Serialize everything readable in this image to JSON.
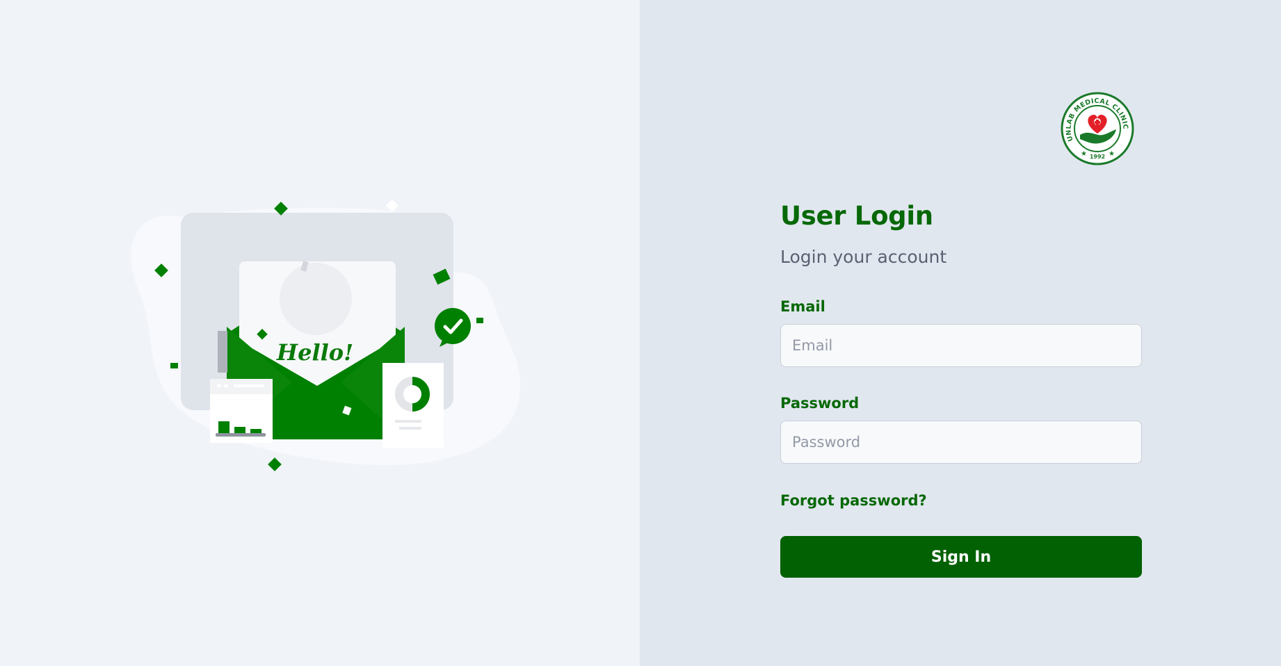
{
  "brand": {
    "logo_text": "UNLAB MEDICAL CLINIC CORP",
    "logo_year": "1992",
    "accent_color": "#066806",
    "button_color": "#026102"
  },
  "illustration": {
    "greeting": "Hello!"
  },
  "login": {
    "title": "User Login",
    "subtitle": "Login your account",
    "email_label": "Email",
    "email_placeholder": "Email",
    "email_value": "",
    "password_label": "Password",
    "password_placeholder": "Password",
    "password_value": "",
    "forgot_label": "Forgot password?",
    "signin_label": "Sign In"
  }
}
